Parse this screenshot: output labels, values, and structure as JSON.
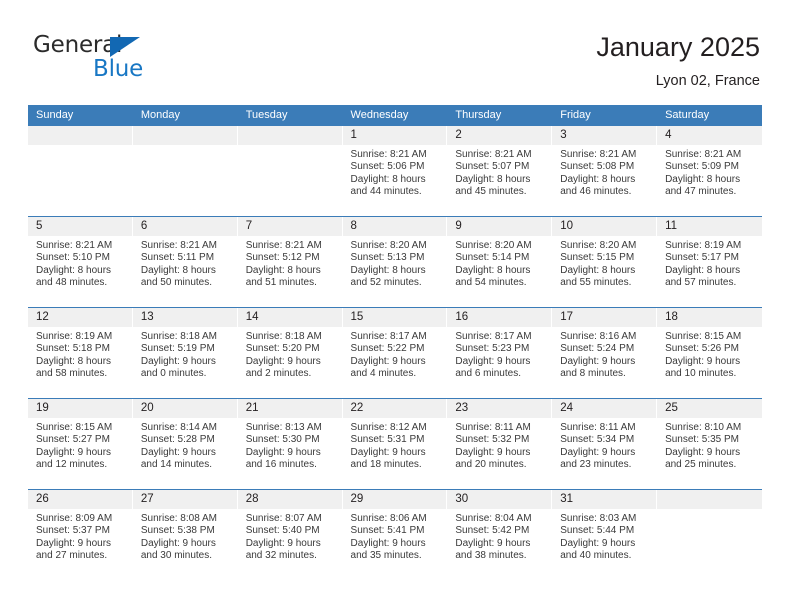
{
  "brand": {
    "name_top": "General",
    "name_bottom": "Blue",
    "triangle_color": "#1268b3",
    "blue_text_color": "#1877c4"
  },
  "header": {
    "title": "January 2025",
    "subtitle": "Lyon 02, France"
  },
  "theme": {
    "header_blue": "#3b7cb8",
    "day_strip_gray": "#f0f0f0",
    "text_color": "#231f20"
  },
  "weekday_headers": [
    "Sunday",
    "Monday",
    "Tuesday",
    "Wednesday",
    "Thursday",
    "Friday",
    "Saturday"
  ],
  "weeks": [
    [
      {
        "day": "",
        "sunrise": "",
        "sunset": "",
        "daylight_1": "",
        "daylight_2": ""
      },
      {
        "day": "",
        "sunrise": "",
        "sunset": "",
        "daylight_1": "",
        "daylight_2": ""
      },
      {
        "day": "",
        "sunrise": "",
        "sunset": "",
        "daylight_1": "",
        "daylight_2": ""
      },
      {
        "day": "1",
        "sunrise": "Sunrise: 8:21 AM",
        "sunset": "Sunset: 5:06 PM",
        "daylight_1": "Daylight: 8 hours",
        "daylight_2": "and 44 minutes."
      },
      {
        "day": "2",
        "sunrise": "Sunrise: 8:21 AM",
        "sunset": "Sunset: 5:07 PM",
        "daylight_1": "Daylight: 8 hours",
        "daylight_2": "and 45 minutes."
      },
      {
        "day": "3",
        "sunrise": "Sunrise: 8:21 AM",
        "sunset": "Sunset: 5:08 PM",
        "daylight_1": "Daylight: 8 hours",
        "daylight_2": "and 46 minutes."
      },
      {
        "day": "4",
        "sunrise": "Sunrise: 8:21 AM",
        "sunset": "Sunset: 5:09 PM",
        "daylight_1": "Daylight: 8 hours",
        "daylight_2": "and 47 minutes."
      }
    ],
    [
      {
        "day": "5",
        "sunrise": "Sunrise: 8:21 AM",
        "sunset": "Sunset: 5:10 PM",
        "daylight_1": "Daylight: 8 hours",
        "daylight_2": "and 48 minutes."
      },
      {
        "day": "6",
        "sunrise": "Sunrise: 8:21 AM",
        "sunset": "Sunset: 5:11 PM",
        "daylight_1": "Daylight: 8 hours",
        "daylight_2": "and 50 minutes."
      },
      {
        "day": "7",
        "sunrise": "Sunrise: 8:21 AM",
        "sunset": "Sunset: 5:12 PM",
        "daylight_1": "Daylight: 8 hours",
        "daylight_2": "and 51 minutes."
      },
      {
        "day": "8",
        "sunrise": "Sunrise: 8:20 AM",
        "sunset": "Sunset: 5:13 PM",
        "daylight_1": "Daylight: 8 hours",
        "daylight_2": "and 52 minutes."
      },
      {
        "day": "9",
        "sunrise": "Sunrise: 8:20 AM",
        "sunset": "Sunset: 5:14 PM",
        "daylight_1": "Daylight: 8 hours",
        "daylight_2": "and 54 minutes."
      },
      {
        "day": "10",
        "sunrise": "Sunrise: 8:20 AM",
        "sunset": "Sunset: 5:15 PM",
        "daylight_1": "Daylight: 8 hours",
        "daylight_2": "and 55 minutes."
      },
      {
        "day": "11",
        "sunrise": "Sunrise: 8:19 AM",
        "sunset": "Sunset: 5:17 PM",
        "daylight_1": "Daylight: 8 hours",
        "daylight_2": "and 57 minutes."
      }
    ],
    [
      {
        "day": "12",
        "sunrise": "Sunrise: 8:19 AM",
        "sunset": "Sunset: 5:18 PM",
        "daylight_1": "Daylight: 8 hours",
        "daylight_2": "and 58 minutes."
      },
      {
        "day": "13",
        "sunrise": "Sunrise: 8:18 AM",
        "sunset": "Sunset: 5:19 PM",
        "daylight_1": "Daylight: 9 hours",
        "daylight_2": "and 0 minutes."
      },
      {
        "day": "14",
        "sunrise": "Sunrise: 8:18 AM",
        "sunset": "Sunset: 5:20 PM",
        "daylight_1": "Daylight: 9 hours",
        "daylight_2": "and 2 minutes."
      },
      {
        "day": "15",
        "sunrise": "Sunrise: 8:17 AM",
        "sunset": "Sunset: 5:22 PM",
        "daylight_1": "Daylight: 9 hours",
        "daylight_2": "and 4 minutes."
      },
      {
        "day": "16",
        "sunrise": "Sunrise: 8:17 AM",
        "sunset": "Sunset: 5:23 PM",
        "daylight_1": "Daylight: 9 hours",
        "daylight_2": "and 6 minutes."
      },
      {
        "day": "17",
        "sunrise": "Sunrise: 8:16 AM",
        "sunset": "Sunset: 5:24 PM",
        "daylight_1": "Daylight: 9 hours",
        "daylight_2": "and 8 minutes."
      },
      {
        "day": "18",
        "sunrise": "Sunrise: 8:15 AM",
        "sunset": "Sunset: 5:26 PM",
        "daylight_1": "Daylight: 9 hours",
        "daylight_2": "and 10 minutes."
      }
    ],
    [
      {
        "day": "19",
        "sunrise": "Sunrise: 8:15 AM",
        "sunset": "Sunset: 5:27 PM",
        "daylight_1": "Daylight: 9 hours",
        "daylight_2": "and 12 minutes."
      },
      {
        "day": "20",
        "sunrise": "Sunrise: 8:14 AM",
        "sunset": "Sunset: 5:28 PM",
        "daylight_1": "Daylight: 9 hours",
        "daylight_2": "and 14 minutes."
      },
      {
        "day": "21",
        "sunrise": "Sunrise: 8:13 AM",
        "sunset": "Sunset: 5:30 PM",
        "daylight_1": "Daylight: 9 hours",
        "daylight_2": "and 16 minutes."
      },
      {
        "day": "22",
        "sunrise": "Sunrise: 8:12 AM",
        "sunset": "Sunset: 5:31 PM",
        "daylight_1": "Daylight: 9 hours",
        "daylight_2": "and 18 minutes."
      },
      {
        "day": "23",
        "sunrise": "Sunrise: 8:11 AM",
        "sunset": "Sunset: 5:32 PM",
        "daylight_1": "Daylight: 9 hours",
        "daylight_2": "and 20 minutes."
      },
      {
        "day": "24",
        "sunrise": "Sunrise: 8:11 AM",
        "sunset": "Sunset: 5:34 PM",
        "daylight_1": "Daylight: 9 hours",
        "daylight_2": "and 23 minutes."
      },
      {
        "day": "25",
        "sunrise": "Sunrise: 8:10 AM",
        "sunset": "Sunset: 5:35 PM",
        "daylight_1": "Daylight: 9 hours",
        "daylight_2": "and 25 minutes."
      }
    ],
    [
      {
        "day": "26",
        "sunrise": "Sunrise: 8:09 AM",
        "sunset": "Sunset: 5:37 PM",
        "daylight_1": "Daylight: 9 hours",
        "daylight_2": "and 27 minutes."
      },
      {
        "day": "27",
        "sunrise": "Sunrise: 8:08 AM",
        "sunset": "Sunset: 5:38 PM",
        "daylight_1": "Daylight: 9 hours",
        "daylight_2": "and 30 minutes."
      },
      {
        "day": "28",
        "sunrise": "Sunrise: 8:07 AM",
        "sunset": "Sunset: 5:40 PM",
        "daylight_1": "Daylight: 9 hours",
        "daylight_2": "and 32 minutes."
      },
      {
        "day": "29",
        "sunrise": "Sunrise: 8:06 AM",
        "sunset": "Sunset: 5:41 PM",
        "daylight_1": "Daylight: 9 hours",
        "daylight_2": "and 35 minutes."
      },
      {
        "day": "30",
        "sunrise": "Sunrise: 8:04 AM",
        "sunset": "Sunset: 5:42 PM",
        "daylight_1": "Daylight: 9 hours",
        "daylight_2": "and 38 minutes."
      },
      {
        "day": "31",
        "sunrise": "Sunrise: 8:03 AM",
        "sunset": "Sunset: 5:44 PM",
        "daylight_1": "Daylight: 9 hours",
        "daylight_2": "and 40 minutes."
      },
      {
        "day": "",
        "sunrise": "",
        "sunset": "",
        "daylight_1": "",
        "daylight_2": ""
      }
    ]
  ]
}
